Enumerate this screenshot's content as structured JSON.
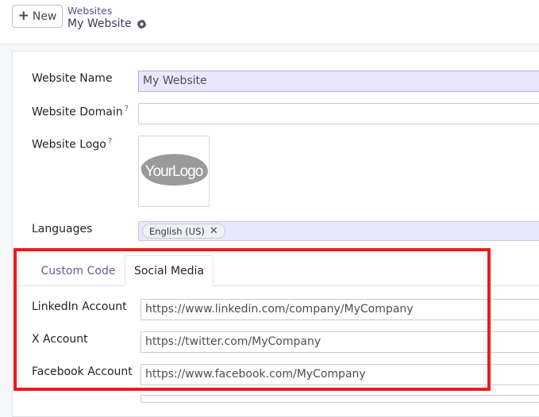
{
  "toolbar": {
    "new_label": "New",
    "breadcrumb": "Websites",
    "current_record": "My Website"
  },
  "form": {
    "website_name": {
      "label": "Website Name",
      "value": "My Website"
    },
    "website_domain": {
      "label": "Website Domain",
      "help": "?",
      "value": ""
    },
    "website_logo": {
      "label": "Website Logo",
      "help": "?",
      "logo_text": "YourLogo"
    },
    "languages": {
      "label": "Languages",
      "tags": [
        "English (US)"
      ],
      "remove_glyph": "✕"
    }
  },
  "tabs": [
    {
      "label": "Custom Code",
      "active": false
    },
    {
      "label": "Social Media",
      "active": true
    }
  ],
  "social": {
    "linkedin": {
      "label": "LinkedIn Account",
      "value": "https://www.linkedin.com/company/MyCompany"
    },
    "x": {
      "label": "X Account",
      "value": "https://twitter.com/MyCompany"
    },
    "facebook": {
      "label": "Facebook Account",
      "value": "https://www.facebook.com/MyCompany"
    }
  },
  "colors": {
    "highlight_border": "#ee1a1a",
    "accent": "#5f4a8b",
    "required_field_bg": "#e9e7fd"
  },
  "icons": {
    "new": "plus-icon",
    "settings": "gear-icon",
    "tag_remove": "close-icon"
  }
}
